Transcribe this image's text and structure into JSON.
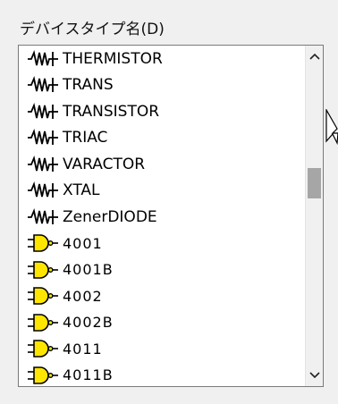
{
  "label": "デバイスタイプ名(D)",
  "items": [
    {
      "text": "THERMISTOR",
      "icon": "resistor-icon"
    },
    {
      "text": "TRANS",
      "icon": "resistor-icon"
    },
    {
      "text": "TRANSISTOR",
      "icon": "resistor-icon"
    },
    {
      "text": "TRIAC",
      "icon": "resistor-icon"
    },
    {
      "text": "VARACTOR",
      "icon": "resistor-icon"
    },
    {
      "text": "XTAL",
      "icon": "resistor-icon"
    },
    {
      "text": "ZenerDIODE",
      "icon": "resistor-icon"
    },
    {
      "text": "4001",
      "icon": "nand-gate-icon"
    },
    {
      "text": "4001B",
      "icon": "nand-gate-icon"
    },
    {
      "text": "4002",
      "icon": "nand-gate-icon"
    },
    {
      "text": "4002B",
      "icon": "nand-gate-icon"
    },
    {
      "text": "4011",
      "icon": "nand-gate-icon"
    },
    {
      "text": "4011B",
      "icon": "nand-gate-icon"
    }
  ],
  "scroll_position": 0.38,
  "colors": {
    "gate_fill": "#ffe600",
    "gate_stroke": "#000000",
    "thumb": "#a6a6a6"
  }
}
